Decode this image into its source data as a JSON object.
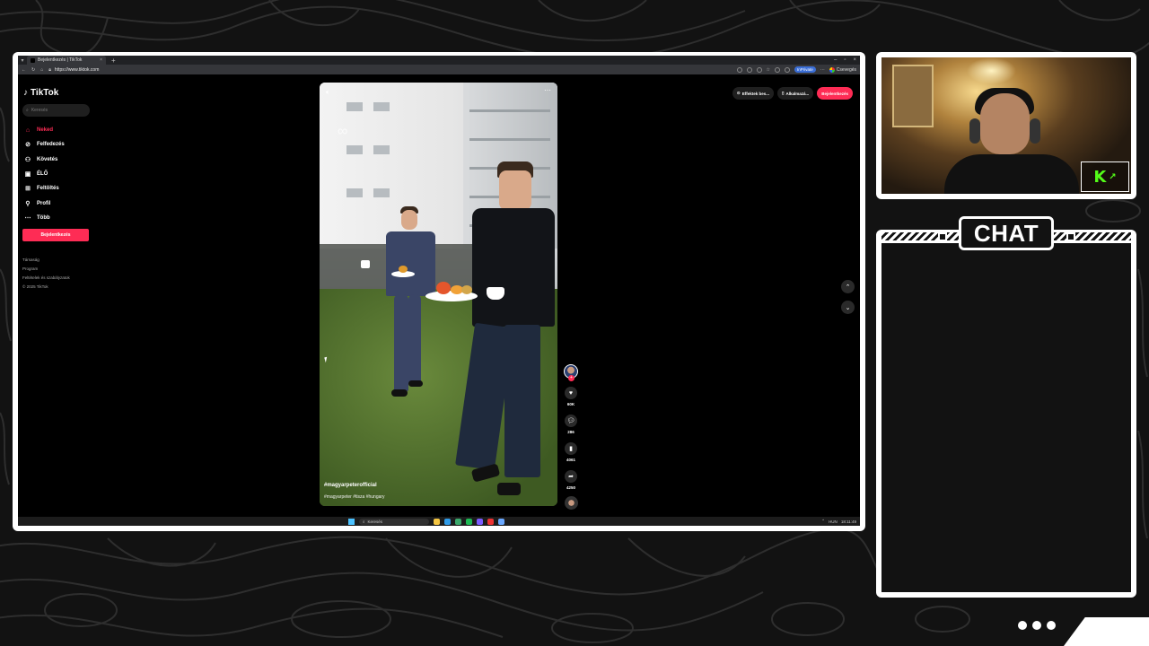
{
  "browser": {
    "tab_title": "Bejelentkezés | TikTok",
    "url": "https://www.tiktok.com",
    "inprivate_label": "InPrivate",
    "profile_label": "Csevegés"
  },
  "tiktok": {
    "logo": "TikTok",
    "search_placeholder": "Keresés",
    "nav": [
      {
        "label": "Neked",
        "icon": "home-icon"
      },
      {
        "label": "Felfedezés",
        "icon": "compass-icon"
      },
      {
        "label": "Követés",
        "icon": "following-icon"
      },
      {
        "label": "ÉLŐ",
        "icon": "live-icon"
      },
      {
        "label": "Feltöltés",
        "icon": "upload-icon"
      },
      {
        "label": "Profil",
        "icon": "profile-icon"
      },
      {
        "label": "Több",
        "icon": "more-icon"
      }
    ],
    "login_button": "Bejelentkezés",
    "footer": [
      "Társaság",
      "Program",
      "Feltételek és szabályzatok",
      "© 2025 TikTok"
    ],
    "top_actions": {
      "effects": "Effektek bes...",
      "app": "Alkalmazá...",
      "login": "Bejelentkezés"
    },
    "video": {
      "author": "#magyarpeterofficial",
      "tags": "#magyarpeter #tisza #hungary"
    },
    "rail": {
      "likes": "60K",
      "comments": "286",
      "saves": "4061",
      "shares": "4250"
    }
  },
  "taskbar": {
    "search_placeholder": "Keresés",
    "lang": "HUN",
    "time": "18:11:49"
  },
  "chat": {
    "title": "CHAT"
  },
  "colors": {
    "tiktok_red": "#fe2c55",
    "kick_green": "#53fc18"
  }
}
